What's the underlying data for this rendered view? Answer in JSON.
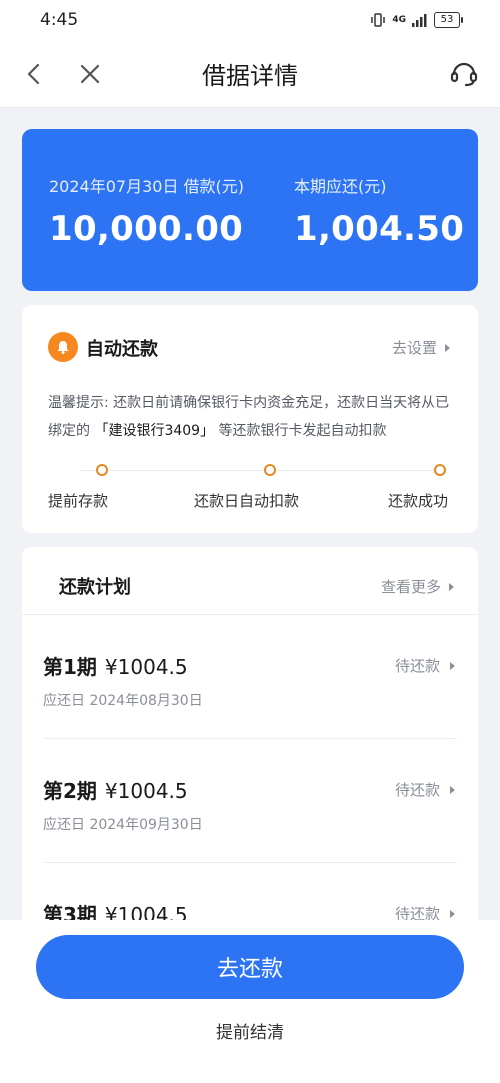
{
  "status_bar": {
    "time": "4:45",
    "network": "4G",
    "battery": "53"
  },
  "nav": {
    "title": "借据详情"
  },
  "loan": {
    "date_label": "2024年07月30日 借款(元)",
    "loan_amount": "10,000.00",
    "due_label": "本期应还(元)",
    "due_amount": "1,004.50"
  },
  "auto_repay": {
    "title": "自动还款",
    "setting": "去设置",
    "tip_prefix": "温馨提示: 还款日前请确保银行卡内资金充足，还款日当天将从已绑定的",
    "bank": "「建设银行3409」",
    "tip_suffix": "等还款银行卡发起自动扣款",
    "steps": [
      "提前存款",
      "还款日自动扣款",
      "还款成功"
    ]
  },
  "plan": {
    "title": "还款计划",
    "more": "查看更多",
    "rows": [
      {
        "period": "第1期",
        "amount": "¥1004.5",
        "status": "待还款",
        "date": "应还日  2024年08月30日"
      },
      {
        "period": "第2期",
        "amount": "¥1004.5",
        "status": "待还款",
        "date": "应还日  2024年09月30日"
      },
      {
        "period": "第3期",
        "amount": "¥1004.5",
        "status": "待还款",
        "date": ""
      }
    ]
  },
  "actions": {
    "pay": "去还款",
    "settle": "提前结清"
  }
}
